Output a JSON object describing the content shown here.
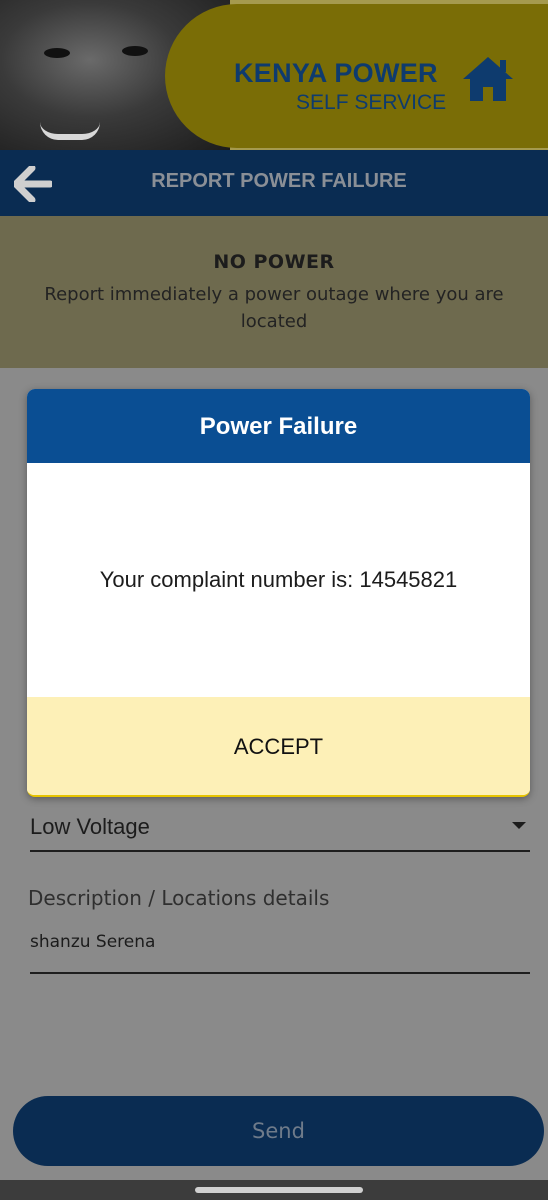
{
  "header": {
    "brand_name": "KENYA POWER",
    "brand_sub": "SELF SERVICE",
    "home_icon": "home-icon"
  },
  "titlebar": {
    "back_icon": "arrow-left-icon",
    "title": "REPORT POWER FAILURE"
  },
  "banner": {
    "heading": "NO POWER",
    "text": "Report immediately a power outage where you are located"
  },
  "form": {
    "failure_type": "Low Voltage",
    "description_label": "Description / Locations details",
    "description_value": "shanzu Serena",
    "send_label": "Send"
  },
  "dialog": {
    "title": "Power Failure",
    "message": "Your complaint number is: 14545821",
    "accept_label": "ACCEPT"
  },
  "colors": {
    "brand_navy": "#0a2c52",
    "dialog_header": "#0a4e93",
    "brand_gold": "#7a6d06",
    "accept_bg": "#fdf0b7"
  }
}
